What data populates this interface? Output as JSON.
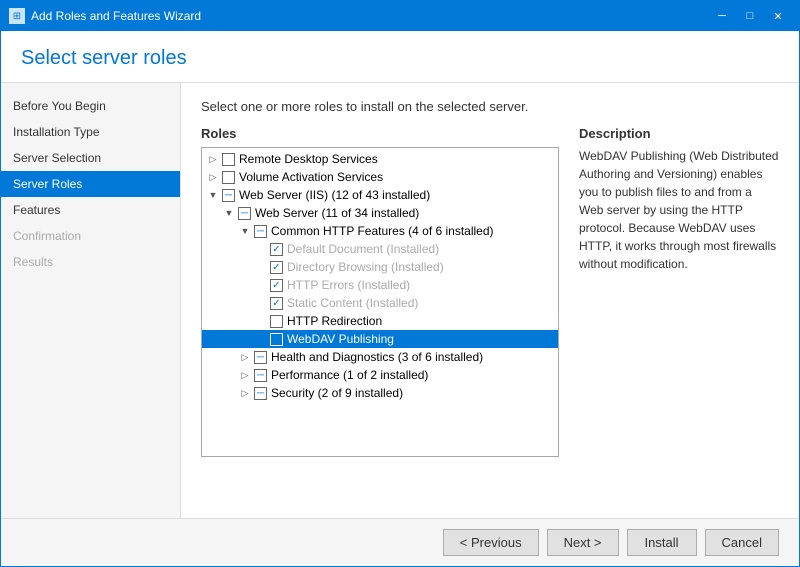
{
  "titlebar": {
    "title": "Add Roles and Features Wizard",
    "icon": "⊞",
    "minimize": "─",
    "maximize": "□",
    "close": "✕"
  },
  "header": {
    "title": "Select server roles"
  },
  "nav": {
    "items": [
      {
        "id": "before-begin",
        "label": "Before You Begin",
        "state": "normal"
      },
      {
        "id": "installation-type",
        "label": "Installation Type",
        "state": "normal"
      },
      {
        "id": "server-selection",
        "label": "Server Selection",
        "state": "normal"
      },
      {
        "id": "server-roles",
        "label": "Server Roles",
        "state": "active"
      },
      {
        "id": "features",
        "label": "Features",
        "state": "normal"
      },
      {
        "id": "confirmation",
        "label": "Confirmation",
        "state": "disabled"
      },
      {
        "id": "results",
        "label": "Results",
        "state": "disabled"
      }
    ]
  },
  "content": {
    "instruction": "Select one or more roles to install on the selected server.",
    "roles_label": "Roles",
    "description_label": "Description",
    "description_text": "WebDAV Publishing (Web Distributed Authoring and Versioning) enables you to publish files to and from a Web server by using the HTTP protocol. Because WebDAV uses HTTP, it works through most firewalls without modification."
  },
  "footer": {
    "previous": "< Previous",
    "next": "Next >",
    "install": "Install",
    "cancel": "Cancel"
  }
}
